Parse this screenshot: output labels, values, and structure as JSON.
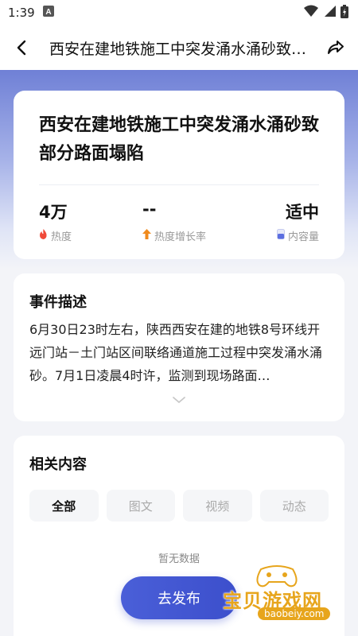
{
  "status": {
    "time": "1:39",
    "notification_icon": "a-square-icon"
  },
  "appbar": {
    "title": "西安在建地铁施工中突发涌水涌砂致部分路面塌陷"
  },
  "headline": "西安在建地铁施工中突发涌水涌砂致部分路面塌陷",
  "stats": [
    {
      "value": "4万",
      "label": "热度",
      "icon": "fire-icon",
      "color": "#f04a3a"
    },
    {
      "value": "--",
      "label": "热度增长率",
      "icon": "arrow-up-icon",
      "color": "#f08a1c"
    },
    {
      "value": "适中",
      "label": "内容量",
      "icon": "capacity-icon",
      "color": "#5b6ee0"
    }
  ],
  "description": {
    "title": "事件描述",
    "text": "6月30日23时左右，陕西西安在建的地铁8号环线开远门站－土门站区间联络通道施工过程中突发涌水涌砂。7月1日凌晨4时许，监测到现场路面…"
  },
  "related": {
    "title": "相关内容",
    "tabs": [
      "全部",
      "图文",
      "视频",
      "动态"
    ],
    "empty_text": "暂无数据"
  },
  "publish_label": "去发布",
  "watermark": {
    "text": "宝贝游戏网",
    "url": "baobeiy.com"
  },
  "colors": {
    "accent": "#3c4fcc",
    "hero": "#6f80d6"
  }
}
